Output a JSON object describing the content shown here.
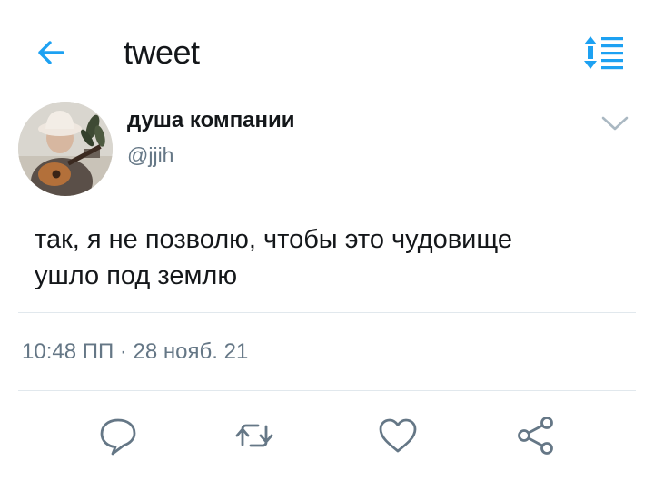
{
  "header": {
    "title": "tweet",
    "back_icon": "arrow-left-icon",
    "sort_icon": "sort-list-icon",
    "accent_color": "#1da1f2"
  },
  "author": {
    "display_name": "душа компании",
    "handle": "@jjih",
    "avatar": "avatar-photo",
    "menu_icon": "chevron-down-icon"
  },
  "tweet": {
    "text_line1": "так, я не позволю, чтобы это чудовище",
    "text_line2": "ушло под землю",
    "timestamp": "10:48 ПП · 28 нояб. 21"
  },
  "actions": {
    "items": [
      "reply-icon",
      "retweet-icon",
      "like-icon",
      "share-icon"
    ],
    "icon_color": "#657786"
  },
  "colors": {
    "text": "#14171a",
    "secondary": "#657786",
    "divider": "#e1e8ed"
  }
}
